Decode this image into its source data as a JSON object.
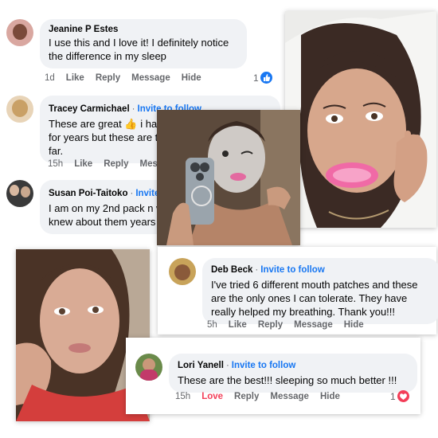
{
  "comments": [
    {
      "name": "Jeanine P Estes",
      "follow": "",
      "text": "I use this and I love it! I definitely notice the difference in my sleep",
      "time": "1d",
      "actions": [
        "Like",
        "Reply",
        "Message",
        "Hide"
      ],
      "reaction_count": "1",
      "reaction": "like-icon"
    },
    {
      "name": "Tracey Carmichael",
      "follow": "Invite to follow",
      "text_line1": "These are great",
      "text_line1_end": "i have",
      "text_line2": "for years but these are th",
      "text_line3": "far.",
      "time": "15h",
      "actions": [
        "Like",
        "Reply",
        "Messa"
      ]
    },
    {
      "name": "Susan Poi-Taitoko",
      "follow": "Invite to",
      "text_line1": "I am on my 2nd pack n wi",
      "text_line2": "knew about them years a"
    },
    {
      "name": "Deb Beck",
      "follow": "Invite to follow",
      "text": "I've tried 6 different mouth patches and these are the only ones I can tolerate. They have really helped my breathing. Thank you!!!",
      "time": "5h",
      "actions": [
        "Like",
        "Reply",
        "Message",
        "Hide"
      ]
    },
    {
      "name": "Lori Yanell",
      "follow": "Invite to follow",
      "text": "These are the best!!! sleeping so much better !!!",
      "time": "15h",
      "actions": [
        "Love",
        "Reply",
        "Message",
        "Hide"
      ],
      "reaction_count": "1",
      "reaction": "love-icon"
    }
  ],
  "colors": {
    "facebook_blue": "#1877f2",
    "love_red": "#f33e58",
    "bubble_gray": "#f0f2f5",
    "meta_gray": "#65676b"
  },
  "photos": {
    "selfie_sleep_patch": "woman lying on pillow with pink mouth patch",
    "mirror_mask": "mirror selfie with face mask and mouth patch",
    "selfie_hand_cheek": "woman resting cheek on hand"
  }
}
